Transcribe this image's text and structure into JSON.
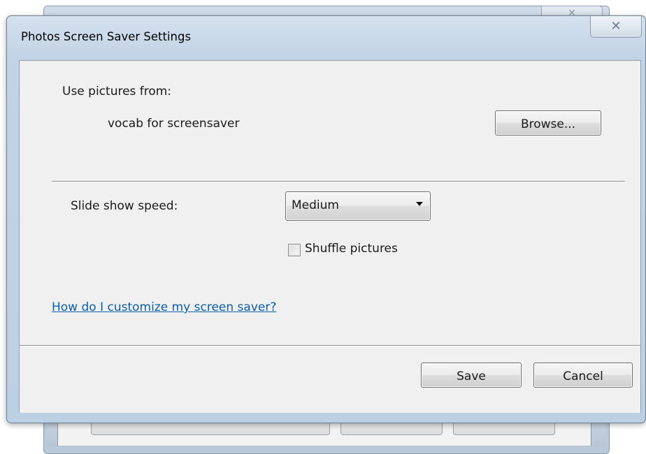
{
  "dialog": {
    "title": "Photos Screen Saver Settings",
    "close_glyph": "✕"
  },
  "source": {
    "label": "Use pictures from:",
    "folder": "vocab for screensaver",
    "browse_label": "Browse..."
  },
  "speed": {
    "label": "Slide show speed:",
    "selected": "Medium"
  },
  "shuffle": {
    "label": "Shuffle pictures",
    "checked": false
  },
  "help_link": "How do I customize my screen saver?",
  "footer": {
    "save_label": "Save",
    "cancel_label": "Cancel"
  },
  "icons": {
    "close": "close-icon",
    "dropdown": "chevron-down-icon"
  }
}
